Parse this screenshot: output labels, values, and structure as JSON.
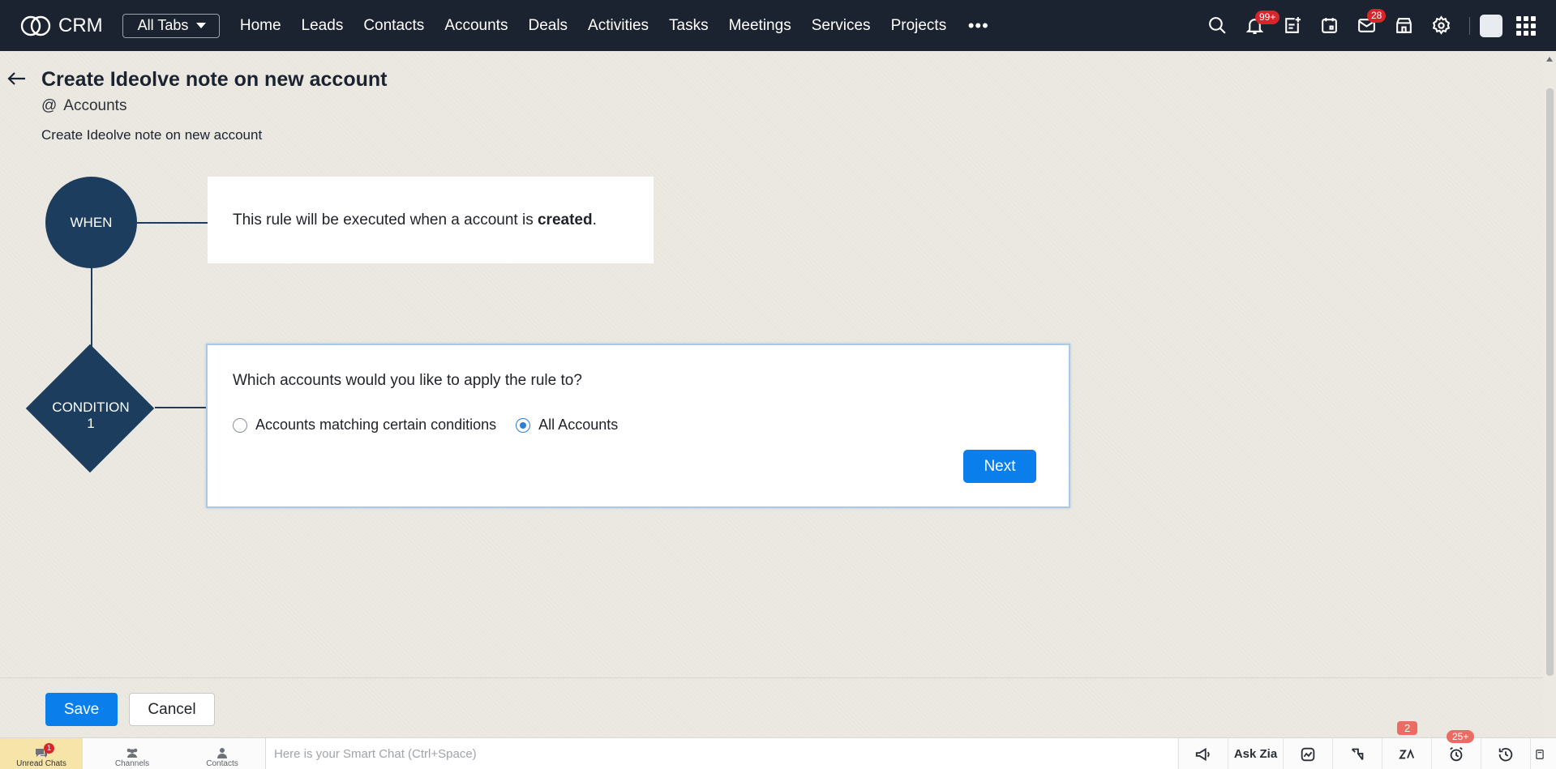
{
  "app": {
    "name": "CRM",
    "all_tabs_label": "All Tabs"
  },
  "nav": {
    "items": [
      "Home",
      "Leads",
      "Contacts",
      "Accounts",
      "Deals",
      "Activities",
      "Tasks",
      "Meetings",
      "Services",
      "Projects"
    ],
    "more": "•••"
  },
  "topbar": {
    "notifications_badge": "99+",
    "mail_badge": "28"
  },
  "page": {
    "title": "Create Ideolve note on new account",
    "module_prefix": "@",
    "module": "Accounts",
    "description": "Create Ideolve note on new account"
  },
  "workflow": {
    "when_label": "WHEN",
    "when_text_pre": "This rule will be executed when a account is ",
    "when_text_bold": "created",
    "when_text_post": ".",
    "condition_label_line1": "CONDITION",
    "condition_label_line2": "1",
    "question": "Which accounts would you like to apply the rule to?",
    "options": [
      {
        "label": "Accounts matching certain conditions",
        "selected": false
      },
      {
        "label": "All Accounts",
        "selected": true
      }
    ],
    "next_label": "Next"
  },
  "footer": {
    "save_label": "Save",
    "cancel_label": "Cancel"
  },
  "chatbar": {
    "unread_label": "Unread Chats",
    "unread_count": "1",
    "channels_label": "Channels",
    "contacts_label": "Contacts",
    "smart_chat_placeholder": "Here is your Smart Chat (Ctrl+Space)",
    "ask_zia": "Ask Zia",
    "zia_badge": "2",
    "reminder_badge": "25+"
  },
  "colors": {
    "topbar": "#1c2330",
    "node": "#1c3d5e",
    "primary_button": "#0a7fec",
    "badge": "#d6262c"
  }
}
